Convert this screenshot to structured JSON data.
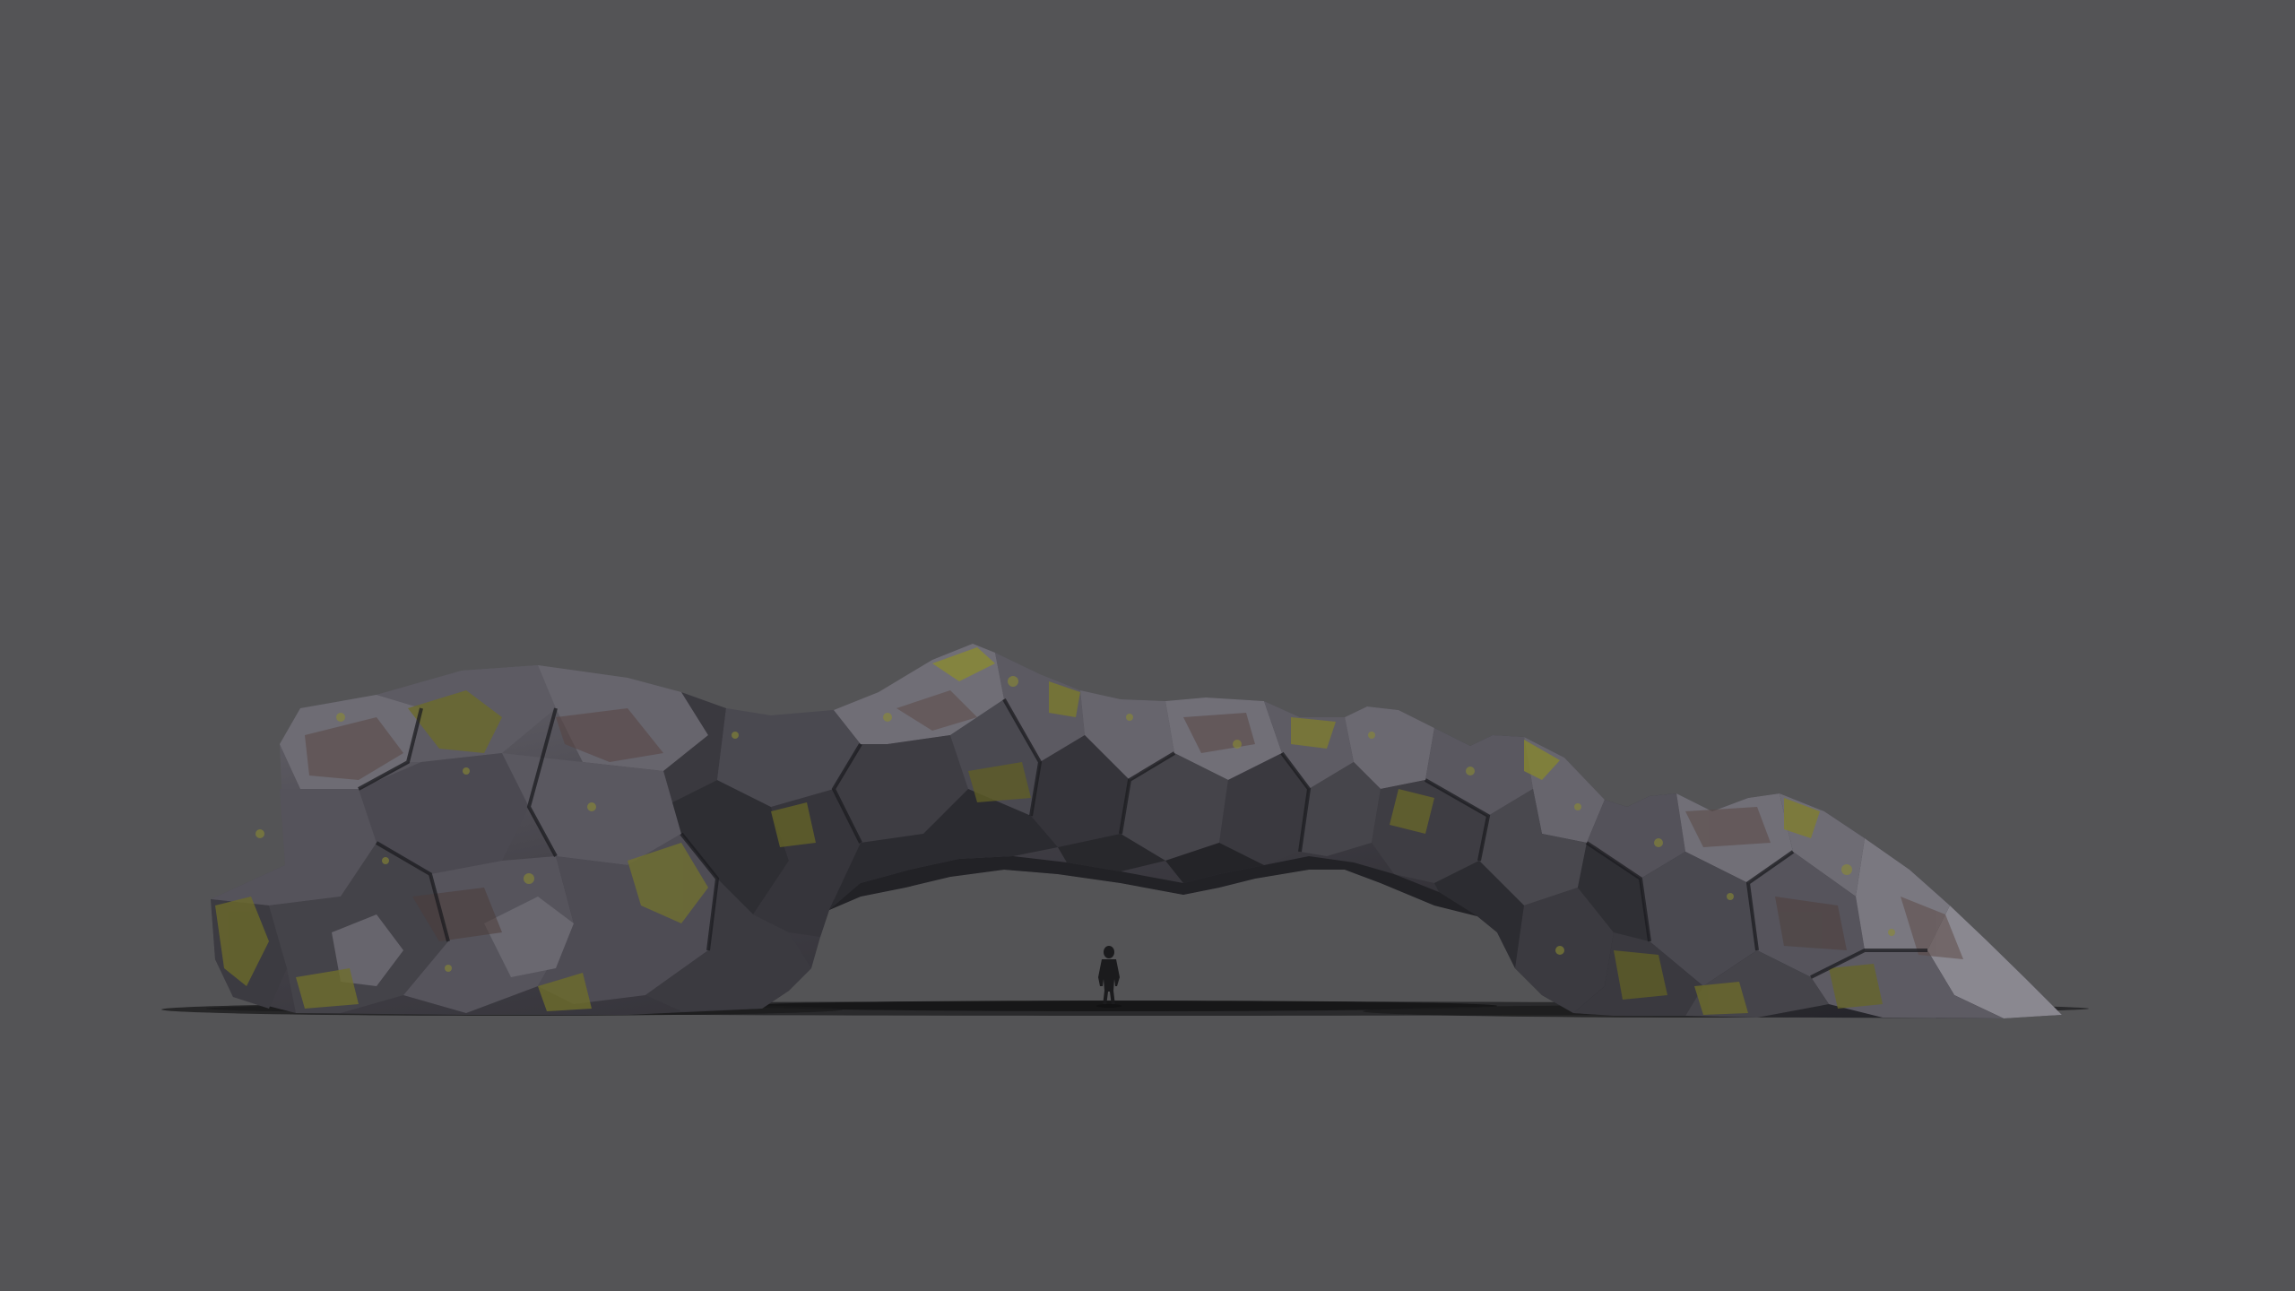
{
  "scene": {
    "subject": "rock-arch",
    "has_scale_figure": true
  },
  "colors": {
    "background": "#545456",
    "ground_shadow": "#1e1e1f",
    "rock_dark": "#26272c",
    "rock_mid": "#3d3c43",
    "rock_light": "#67666e",
    "rock_highlight": "#8d8b94",
    "rock_brown": "#4a3d3b",
    "moss": "#6b6a2a",
    "moss_bright": "#8a8a32",
    "figure": "#1b1b1d"
  },
  "icons": {
    "figure": "human-silhouette"
  }
}
